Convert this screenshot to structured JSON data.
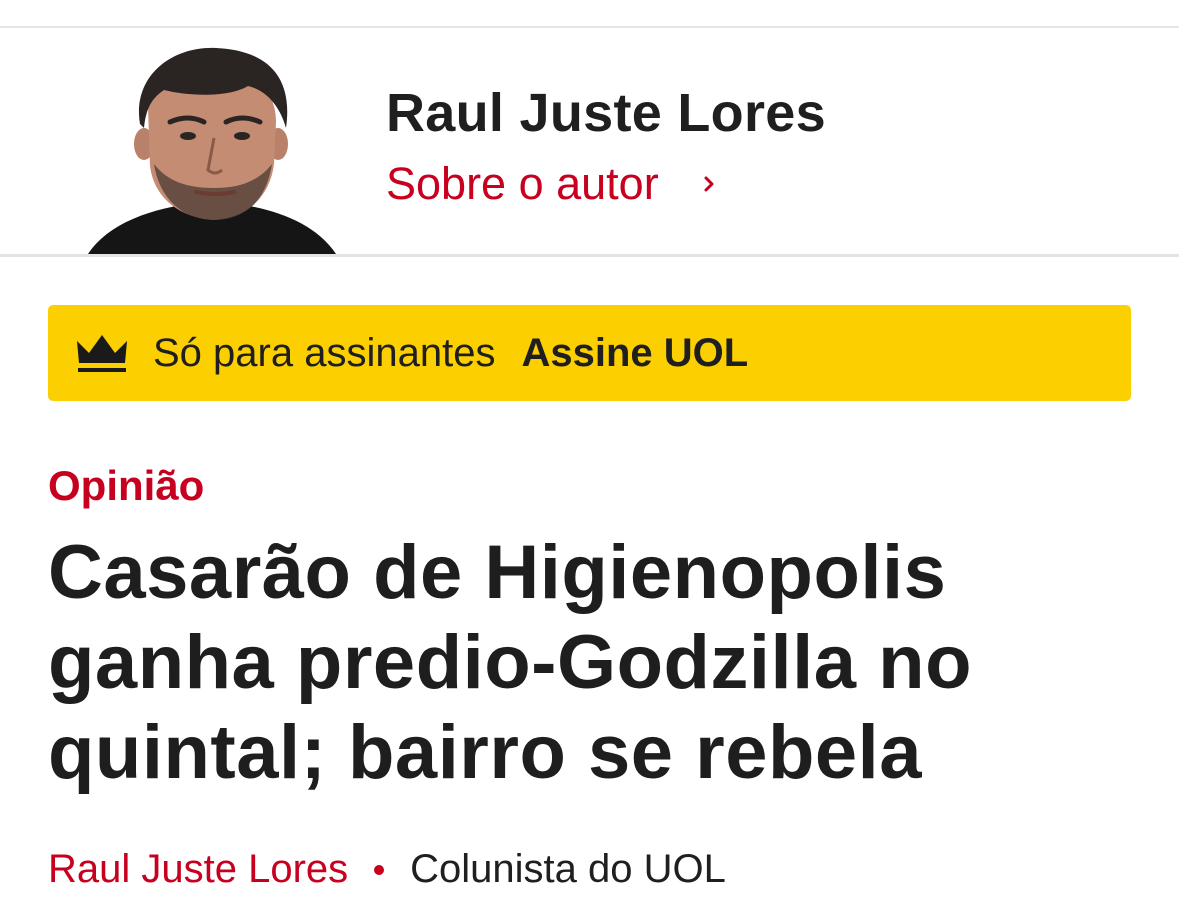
{
  "author_header": {
    "name": "Raul Juste Lores",
    "about_link": "Sobre o autor"
  },
  "subscription_banner": {
    "text": "Só para assinantes",
    "cta": "Assine UOL",
    "background_color": "#fbcf00",
    "icon": "crown-icon"
  },
  "article": {
    "kicker": "Opinião",
    "headline": "Casarão de Higienopolis ganha predio-Godzilla no quintal; bairro se rebela",
    "byline": {
      "author": "Raul Juste Lores",
      "role": "Colunista do UOL"
    }
  },
  "colors": {
    "accent": "#c8001f",
    "text": "#1f1f1f"
  }
}
